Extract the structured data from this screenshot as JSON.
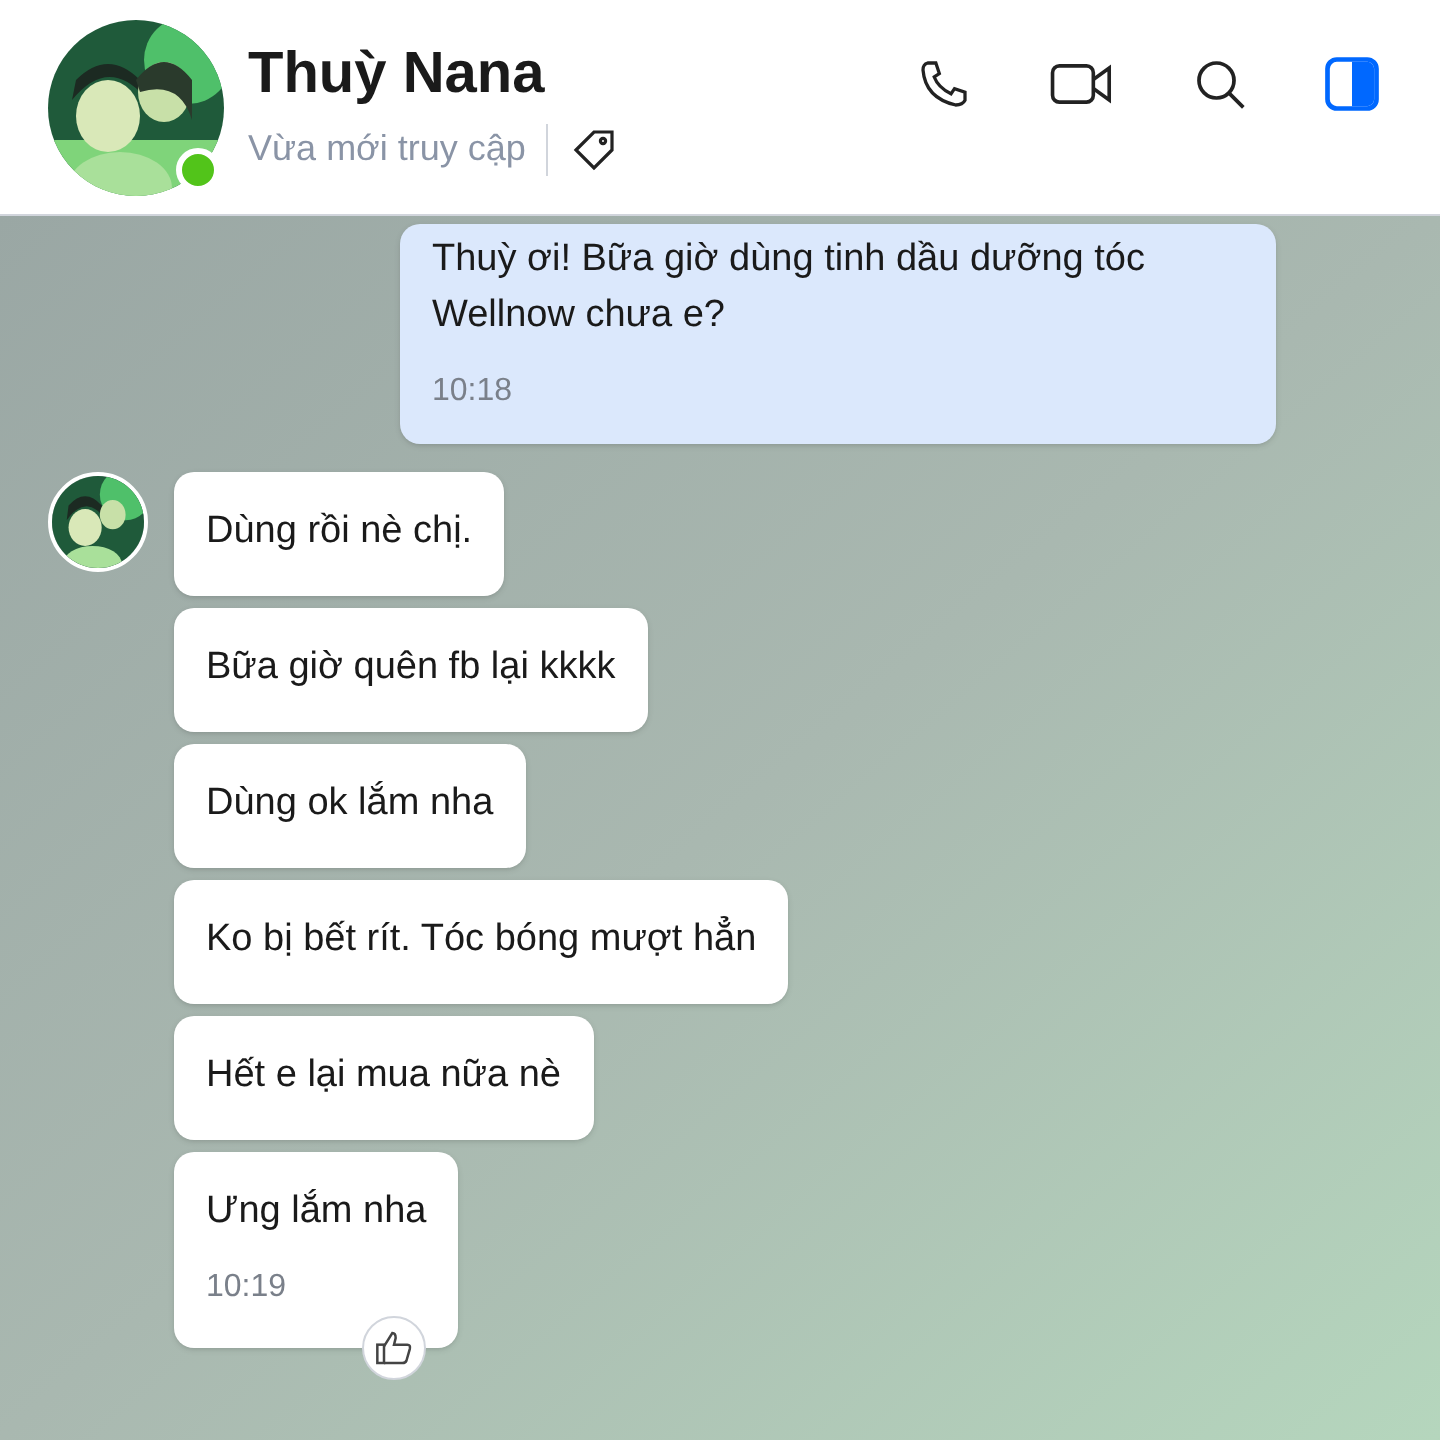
{
  "header": {
    "name": "Thuỳ Nana",
    "status": "Vừa mới truy cập",
    "online": true
  },
  "messages": [
    {
      "kind": "sent",
      "text": "Thuỳ ơi! Bữa giờ dùng tinh dầu dưỡng tóc Wellnow chưa e?",
      "time": "10:18"
    },
    {
      "kind": "received",
      "text": "Dùng rồi nè chị.",
      "avatar": true
    },
    {
      "kind": "received",
      "text": "Bữa giờ quên fb lại kkkk"
    },
    {
      "kind": "received",
      "text": "Dùng ok lắm nha"
    },
    {
      "kind": "received",
      "text": "Ko bị bết rít. Tóc bóng mượt hẳn"
    },
    {
      "kind": "received",
      "text": "Hết e lại mua nữa nè"
    },
    {
      "kind": "received",
      "text": "Ưng lắm nha",
      "time": "10:19",
      "like": true
    }
  ]
}
